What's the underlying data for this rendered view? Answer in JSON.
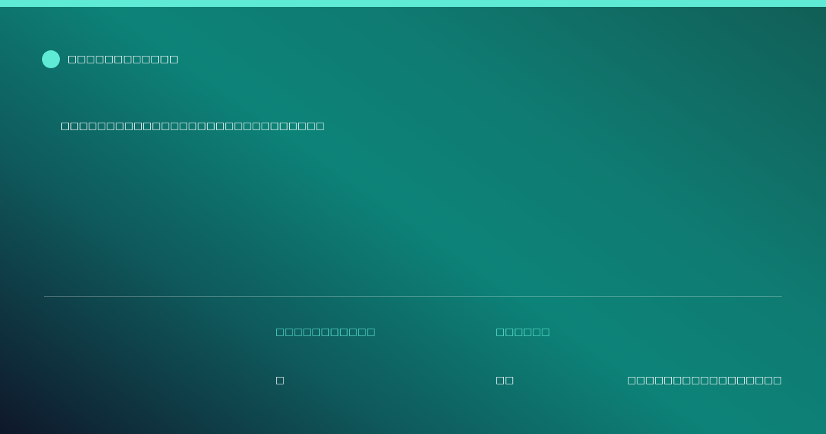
{
  "colors": {
    "accent": "#5eead4",
    "gradient_dark": "#0f172a",
    "gradient_teal": "#0d8378",
    "text": "#ffffff"
  },
  "brand": {
    "name": "□□□□□□□□□□□□"
  },
  "headline": "□□□□□□□□□□□□□□□□□□□□□□□□□□□□□",
  "stats": [
    {
      "label": "□□□□□□□□□□□",
      "value": "□"
    },
    {
      "label": "□□□□□□",
      "value": "□□"
    }
  ],
  "footer_note": "□□□□□□□□□□□□□□□□□"
}
